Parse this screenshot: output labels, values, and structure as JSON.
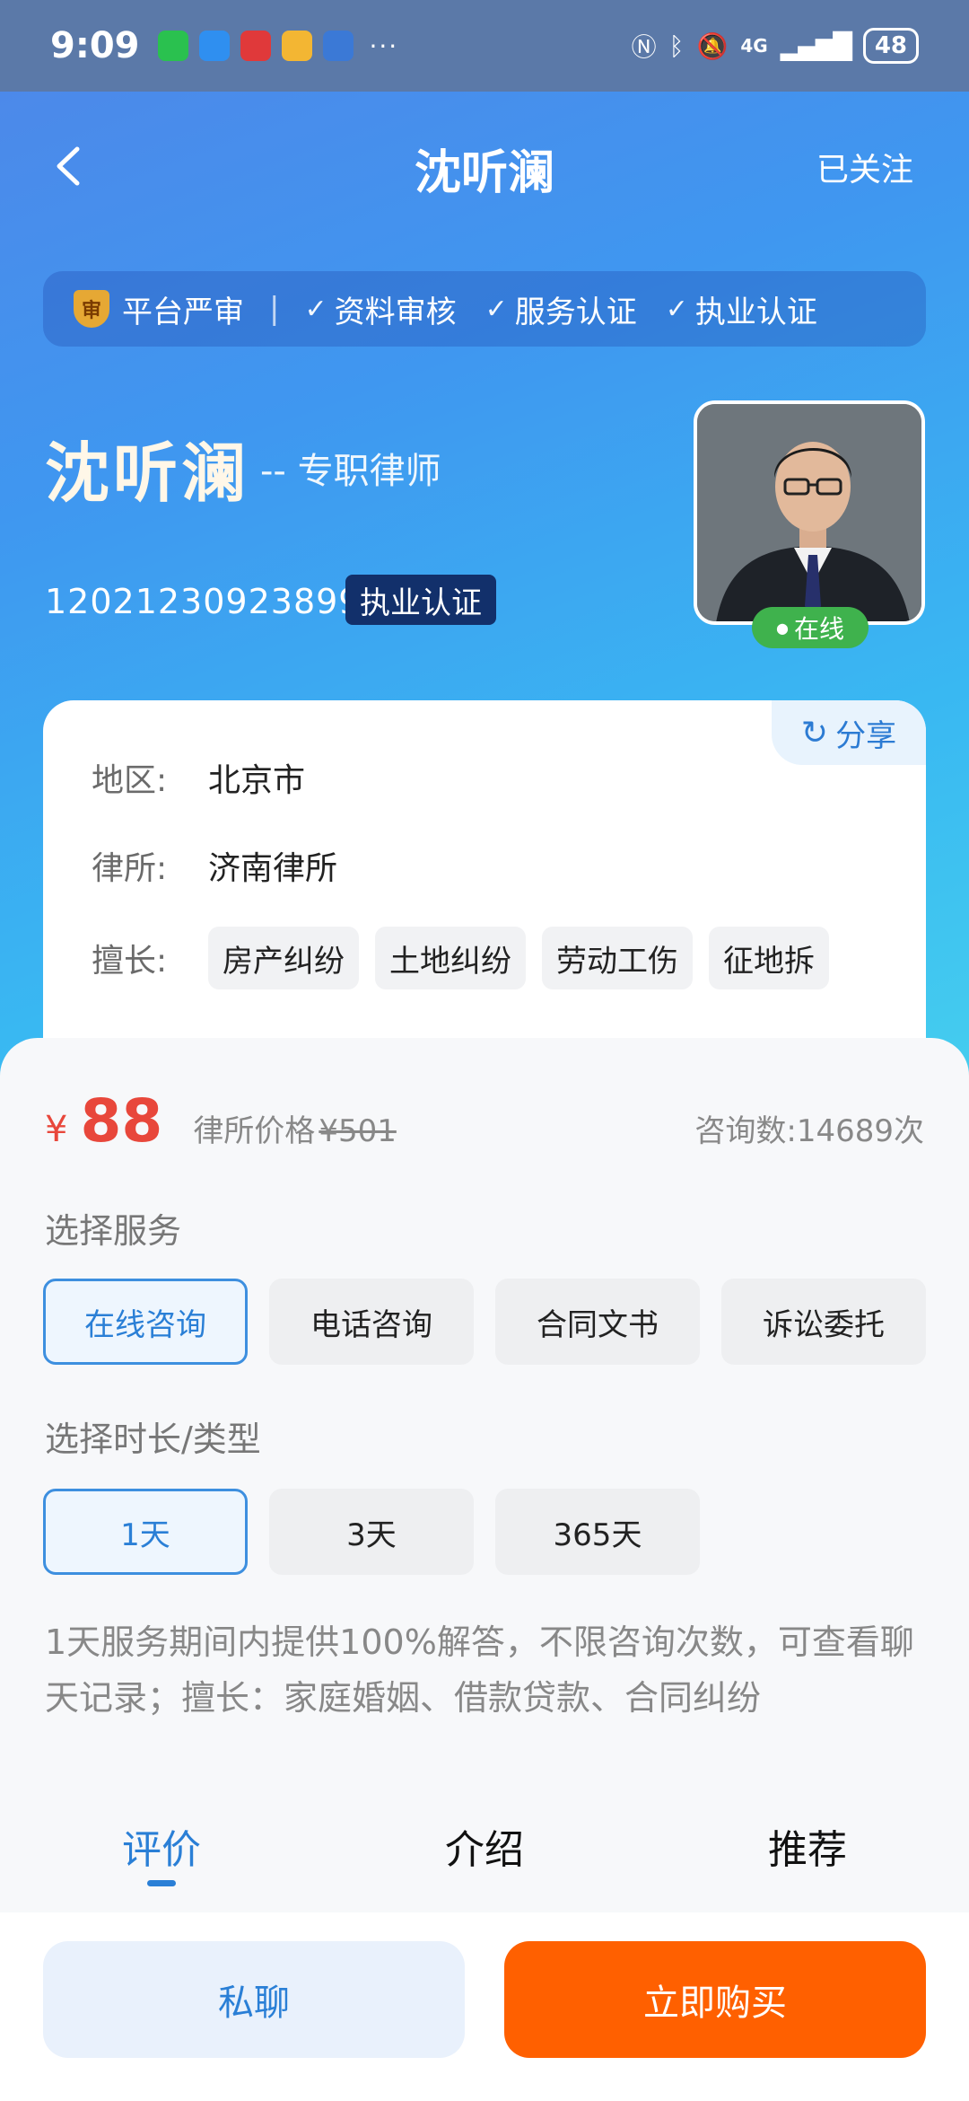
{
  "statusbar": {
    "time": "9:09",
    "more": "···",
    "network": "4G",
    "battery": "48"
  },
  "nav": {
    "title": "沈听澜",
    "follow": "已关注"
  },
  "audit": {
    "title": "平台严审",
    "items": [
      "资料审核",
      "服务认证",
      "执业认证"
    ]
  },
  "profile": {
    "name": "沈听澜",
    "role": "-- 专职律师",
    "license_no": "12021230923899",
    "license_badge": "执业认证",
    "online": "在线"
  },
  "info": {
    "share": "分享",
    "region_label": "地区:",
    "region": "北京市",
    "firm_label": "律所:",
    "firm": "济南律所",
    "skills_label": "擅长:",
    "skills": [
      "房产纠纷",
      "土地纠纷",
      "劳动工伤",
      "征地拆"
    ]
  },
  "pricing": {
    "currency": "¥",
    "price": "88",
    "orig_label": "律所价格",
    "orig_price": "¥501",
    "consult_count": "咨询数:14689次"
  },
  "service": {
    "title": "选择服务",
    "options": [
      "在线咨询",
      "电话咨询",
      "合同文书",
      "诉讼委托"
    ]
  },
  "duration": {
    "title": "选择时长/类型",
    "options": [
      "1天",
      "3天",
      "365天"
    ]
  },
  "description": "1天服务期间内提供100%解答，不限咨询次数，可查看聊天记录；擅长：家庭婚姻、借款贷款、合同纠纷",
  "tabs": [
    "评价",
    "介绍",
    "推荐"
  ],
  "actions": {
    "chat": "私聊",
    "buy": "立即购买"
  },
  "colors": {
    "accent": "#2a7fd6",
    "buy": "#ff6000",
    "price": "#e8473b",
    "online": "#3fb24d"
  }
}
